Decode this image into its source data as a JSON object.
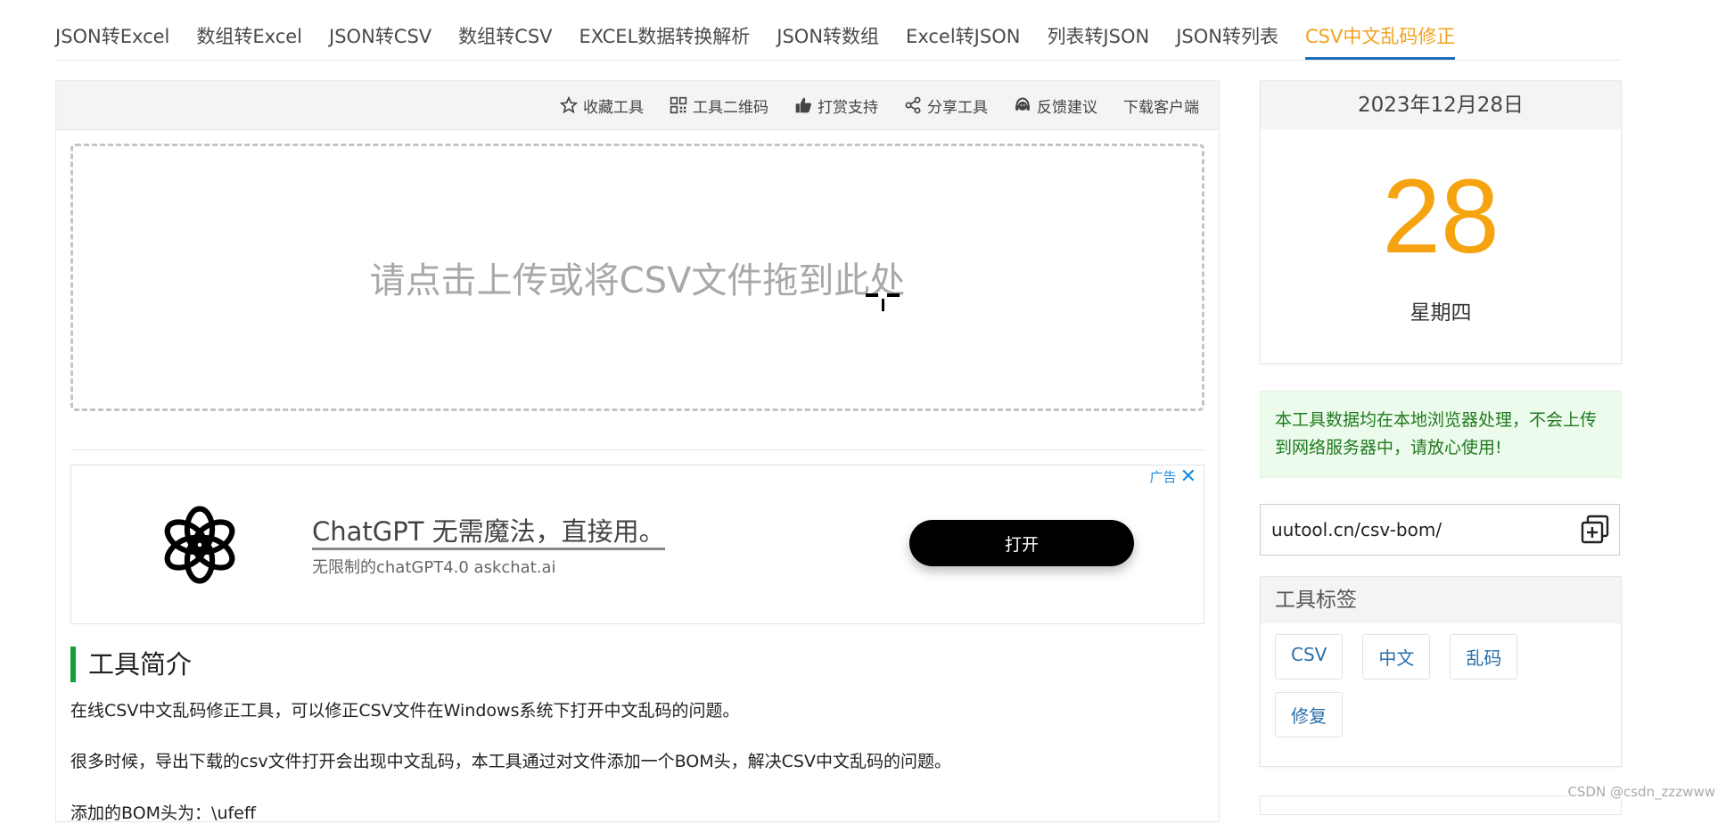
{
  "nav": {
    "items": [
      {
        "label": "JSON转Excel"
      },
      {
        "label": "数组转Excel"
      },
      {
        "label": "JSON转CSV"
      },
      {
        "label": "数组转CSV"
      },
      {
        "label": "EXCEL数据转换解析"
      },
      {
        "label": "JSON转数组"
      },
      {
        "label": "Excel转JSON"
      },
      {
        "label": "列表转JSON"
      },
      {
        "label": "JSON转列表"
      },
      {
        "label": "CSV中文乱码修正",
        "active": true
      }
    ]
  },
  "toolbar": {
    "favorite": "收藏工具",
    "qrcode": "工具二维码",
    "reward": "打赏支持",
    "share": "分享工具",
    "feedback": "反馈建议",
    "download": "下载客户端"
  },
  "dropzone": {
    "text": "请点击上传或将CSV文件拖到此处"
  },
  "ad": {
    "label": "广告",
    "title": "ChatGPT 无需魔法，直接用。",
    "subtitle": "无限制的chatGPT4.0 askchat.ai",
    "button": "打开"
  },
  "intro": {
    "title": "工具简介",
    "p1": "在线CSV中文乱码修正工具，可以修正CSV文件在Windows系统下打开中文乱码的问题。",
    "p2": "很多时候，导出下载的csv文件打开会出现中文乱码，本工具通过对文件添加一个BOM头，解决CSV中文乱码的问题。",
    "p3": "添加的BOM头为：\\ufeff"
  },
  "date": {
    "full": "2023年12月28日",
    "day": "28",
    "weekday": "星期四"
  },
  "notice": {
    "text": "本工具数据均在本地浏览器处理，不会上传到网络服务器中，请放心使用!"
  },
  "url": {
    "text": "uutool.cn/csv-bom/"
  },
  "tags": {
    "title": "工具标签",
    "items": [
      "CSV",
      "中文",
      "乱码",
      "修复"
    ]
  },
  "watermark": "CSDN @csdn_zzzwww",
  "colors": {
    "accent_active": "#f0a31c",
    "active_underline": "#1e6fb9",
    "date_number": "#f5a30f",
    "notice_bg": "#edfbec",
    "notice_text": "#1f7a1f",
    "intro_bar": "#13a038"
  }
}
